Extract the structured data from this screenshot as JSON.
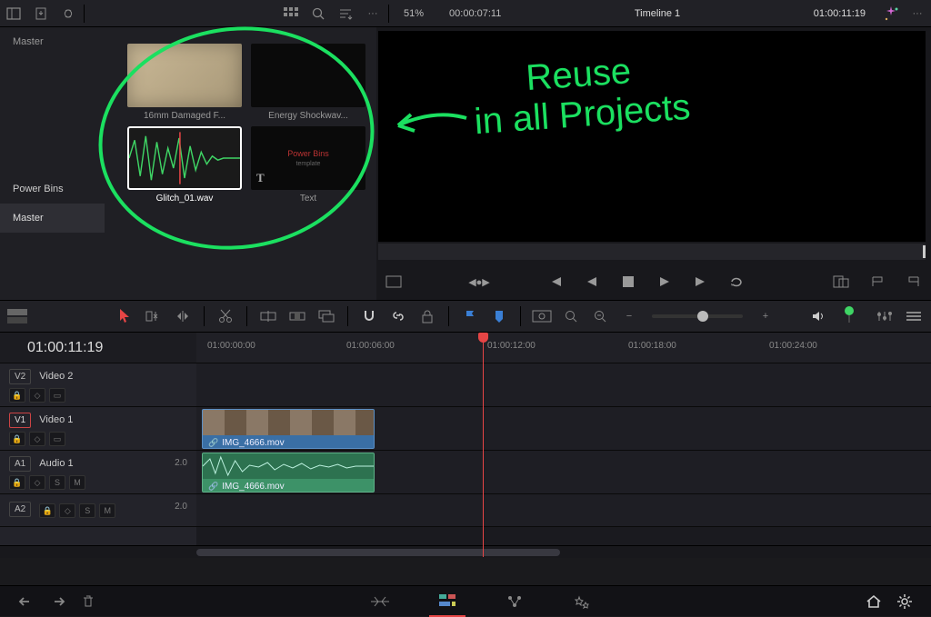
{
  "topbar": {
    "zoom": "51%",
    "source_tc": "00:00:07:11",
    "timeline_name": "Timeline 1",
    "record_tc": "01:00:11:19"
  },
  "sidebar": {
    "master": "Master",
    "powerbins": "Power Bins",
    "powerbins_master": "Master"
  },
  "clips": {
    "c1": "16mm Damaged F...",
    "c2": "Energy Shockwav...",
    "c3": "Glitch_01.wav",
    "c4": "Text",
    "text_preview_top": "Power Bins",
    "text_preview_sub": "template"
  },
  "timeline": {
    "playhead_tc": "01:00:11:19",
    "ticks": [
      "01:00:00:00",
      "01:00:06:00",
      "01:00:12:00",
      "01:00:18:00",
      "01:00:24:00"
    ],
    "tracks": {
      "v2": {
        "id": "V2",
        "name": "Video 2"
      },
      "v1": {
        "id": "V1",
        "name": "Video 1"
      },
      "a1": {
        "id": "A1",
        "name": "Audio 1",
        "level": "2.0"
      },
      "a2": {
        "id": "A2",
        "name": "",
        "level": "2.0"
      }
    },
    "video_clip": "IMG_4666.mov",
    "audio_clip": "IMG_4666.mov"
  },
  "annotation": {
    "line1": "Reuse",
    "line2": "in all Projects"
  }
}
